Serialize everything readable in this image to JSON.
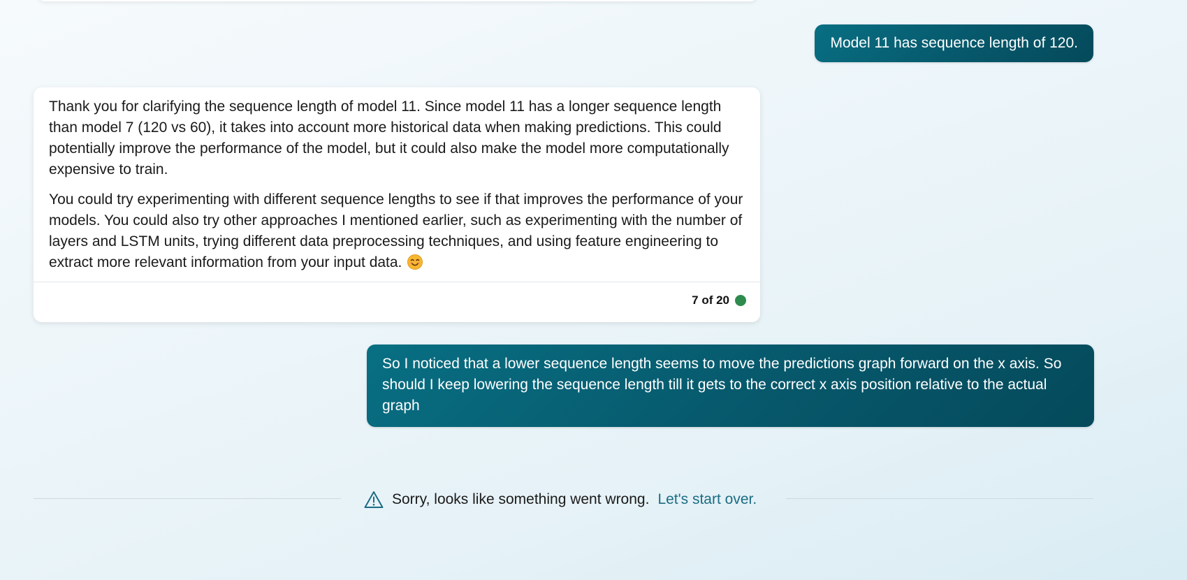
{
  "conversation": {
    "user_message_1": "Model 11 has sequence length of 120.",
    "bot_reply": {
      "paragraph_1": "Thank you for clarifying the sequence length of model 11. Since model 11 has a longer sequence length than model 7 (120 vs 60), it takes into account more historical data when making predictions. This could potentially improve the performance of the model, but it could also make the model more computationally expensive to train.",
      "paragraph_2": "You could try experimenting with different sequence lengths to see if that improves the performance of your models. You could also try other approaches I mentioned earlier, such as experimenting with the number of layers and LSTM units, trying different data preprocessing techniques, and using feature engineering to extract more relevant information from your input data.",
      "emoji": "smiling-face-icon",
      "counter": "7 of 20",
      "counter_dot_color": "#2e8b4e"
    },
    "user_message_2": "So I noticed that a lower sequence length seems to move the predictions graph forward on the x axis. So should I keep lowering the sequence length till it gets to the correct x axis position relative to the actual graph"
  },
  "error": {
    "icon": "warning-triangle-icon",
    "message": "Sorry, looks like something went wrong.",
    "link_text": "Let's start over."
  },
  "colors": {
    "user_bubble": "#07586b",
    "link": "#1b6c84",
    "warning_icon": "#1b6c84"
  }
}
